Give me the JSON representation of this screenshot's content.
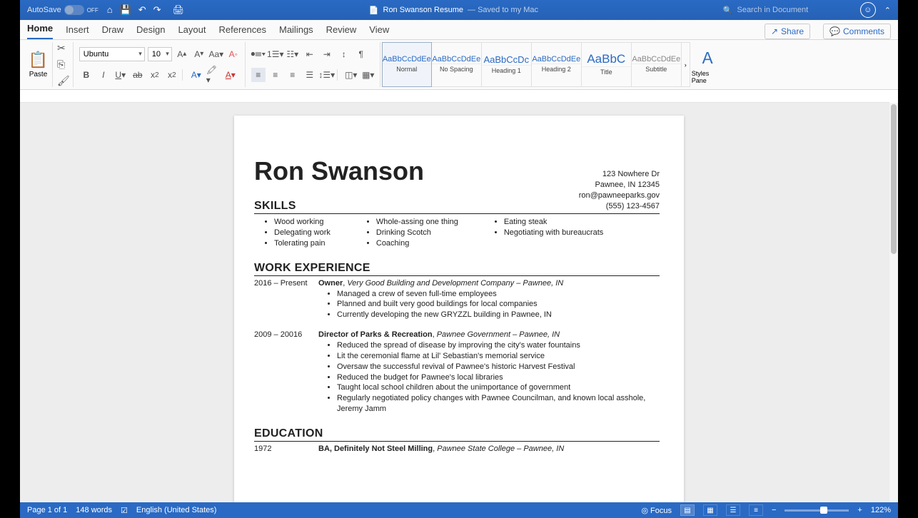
{
  "titlebar": {
    "autosave": "AutoSave",
    "autosave_state": "OFF",
    "doc": "Ron Swanson Resume",
    "saved": "— Saved to my Mac",
    "search_placeholder": "Search in Document"
  },
  "tabs": [
    "Home",
    "Insert",
    "Draw",
    "Design",
    "Layout",
    "References",
    "Mailings",
    "Review",
    "View"
  ],
  "active_tab": "Home",
  "share": "Share",
  "comments": "Comments",
  "font": {
    "name": "Ubuntu",
    "size": "10"
  },
  "styles": [
    {
      "prev": "AaBbCcDdEe",
      "name": "Normal",
      "active": true
    },
    {
      "prev": "AaBbCcDdEe",
      "name": "No Spacing"
    },
    {
      "prev": "AaBbCcDc",
      "name": "Heading 1"
    },
    {
      "prev": "AaBbCcDdEe",
      "name": "Heading 2"
    },
    {
      "prev": "AaBbC",
      "name": "Title",
      "big": true
    },
    {
      "prev": "AaBbCcDdEe",
      "name": "Subtitle"
    }
  ],
  "styles_pane": "Styles Pane",
  "paste": "Paste",
  "resume": {
    "name": "Ron Swanson",
    "contact": [
      "123 Nowhere Dr",
      "Pawnee, IN 12345",
      "ron@pawneeparks.gov",
      "(555) 123-4567"
    ],
    "skills_hdr": "SKILLS",
    "skills": [
      [
        "Wood working",
        "Delegating work",
        "Tolerating pain"
      ],
      [
        "Whole-assing one thing",
        "Drinking Scotch",
        "Coaching"
      ],
      [
        "Eating steak",
        "Negotiating with bureaucrats"
      ]
    ],
    "work_hdr": "WORK EXPERIENCE",
    "jobs": [
      {
        "dates": "2016 – Present",
        "title": "Owner",
        "company": "Very Good Building and Development Company – Pawnee, IN",
        "bullets": [
          "Managed a crew of seven full-time employees",
          "Planned and built very good buildings for local companies",
          "Currently developing the new GRYZZL building in Pawnee, IN"
        ]
      },
      {
        "dates": "2009 – 20016",
        "title": "Director of Parks & Recreation",
        "company": "Pawnee Government – Pawnee, IN",
        "bullets": [
          "Reduced the spread of disease by improving the city's water fountains",
          "Lit the ceremonial flame at Lil' Sebastian's memorial service",
          "Oversaw the successful revival of Pawnee's historic Harvest Festival",
          "Reduced the budget for Pawnee's local libraries",
          "Taught local school children about the unimportance of government",
          "Regularly negotiated policy changes with Pawnee Councilman, and known local asshole, Jeremy Jamm"
        ]
      }
    ],
    "edu_hdr": "EDUCATION",
    "edu": {
      "year": "1972",
      "degree": "BA, Definitely Not Steel Milling",
      "school": "Pawnee State College – Pawnee, IN"
    }
  },
  "status": {
    "page": "Page 1 of 1",
    "words": "148 words",
    "lang": "English (United States)",
    "focus": "Focus",
    "zoom": "122%"
  }
}
